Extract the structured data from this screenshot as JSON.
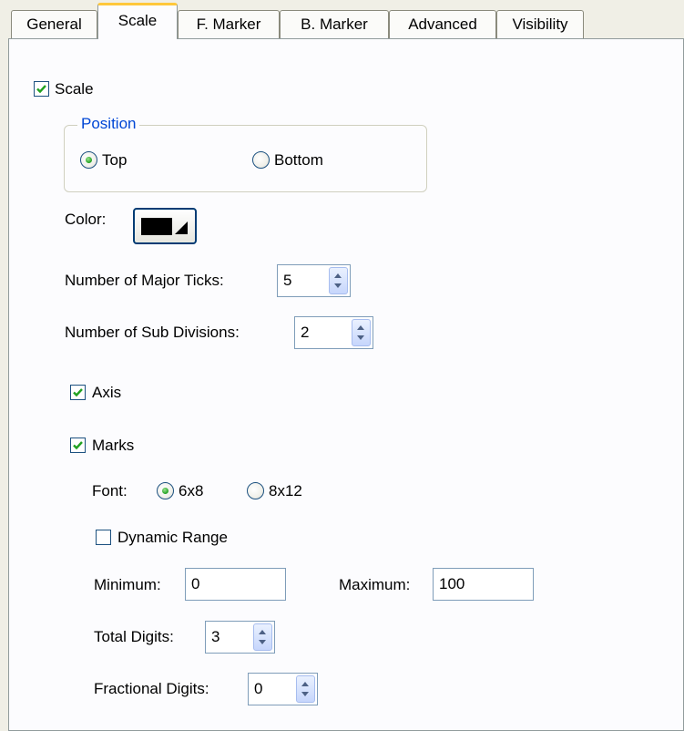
{
  "tabs": [
    "General",
    "Scale",
    "F. Marker",
    "B. Marker",
    "Advanced",
    "Visibility"
  ],
  "scale_checkbox": {
    "label": "Scale",
    "checked": true
  },
  "position_group": {
    "title": "Position",
    "options": [
      {
        "label": "Top",
        "selected": true
      },
      {
        "label": "Bottom",
        "selected": false
      }
    ]
  },
  "color": {
    "label": "Color:",
    "value": "#000000"
  },
  "major_ticks": {
    "label": "Number of Major Ticks:",
    "value": "5"
  },
  "sub_divisions": {
    "label": "Number of Sub Divisions:",
    "value": "2"
  },
  "axis_checkbox": {
    "label": "Axis",
    "checked": true
  },
  "marks_checkbox": {
    "label": "Marks",
    "checked": true
  },
  "font": {
    "label": "Font:",
    "options": [
      {
        "label": "6x8",
        "selected": true
      },
      {
        "label": "8x12",
        "selected": false
      }
    ]
  },
  "dynamic_range": {
    "label": "Dynamic Range",
    "checked": false
  },
  "minimum": {
    "label": "Minimum:",
    "value": "0"
  },
  "maximum": {
    "label": "Maximum:",
    "value": "100"
  },
  "total_digits": {
    "label": "Total Digits:",
    "value": "3"
  },
  "fractional_digits": {
    "label": "Fractional Digits:",
    "value": "0"
  },
  "colors": {
    "check_green": "#21a121",
    "accent_tab": "#ffc83c",
    "groupbox_title": "#0046d5"
  }
}
